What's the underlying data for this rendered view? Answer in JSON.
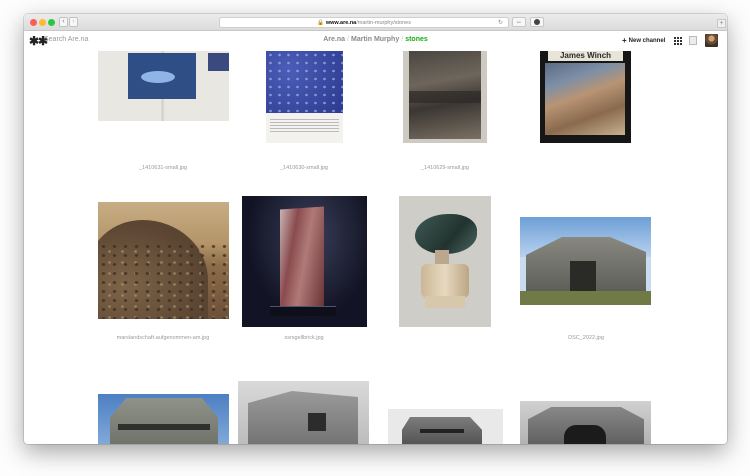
{
  "browser": {
    "url_host": "www.are.na",
    "url_path": "/martin-murphy/stones",
    "lock_glyph": "🔒",
    "reload_glyph": "↻",
    "back_glyph": "‹",
    "forward_glyph": "›",
    "resize_glyph": "↔",
    "new_tab_glyph": "+"
  },
  "header": {
    "logo": "✱✱",
    "search_placeholder": "Search Are.na",
    "breadcrumb": {
      "root": "Are.na",
      "user": "Martin Murphy",
      "channel": "stones",
      "separator": "/"
    },
    "new_channel_label": "New channel",
    "new_channel_glyph": "+",
    "accent_color": "#17ac10"
  },
  "grid": {
    "captions": [
      "_1410631-small.jpg",
      "_1410630-small.jpg",
      "_1410629-small.jpg",
      "",
      "marslandschaft-aufgenommen-am.jpg",
      "ssrsgellbrick.jpg",
      "",
      "DSC_2022.jpg"
    ],
    "book_header_text": "James Winch"
  }
}
